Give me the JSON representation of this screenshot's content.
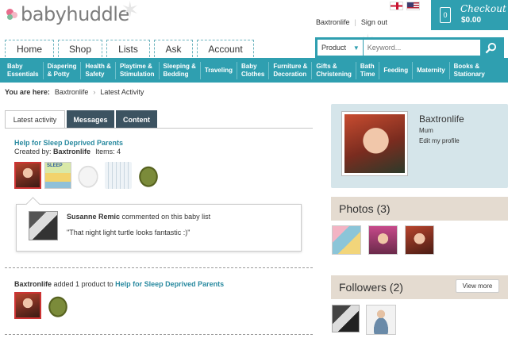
{
  "header": {
    "logo_text": "babyhuddle",
    "user_name": "Baxtronlife",
    "sign_out": "Sign out",
    "checkout_label": "Checkout",
    "cart_count": "0",
    "cart_total": "$0.00",
    "flags": [
      "uk-flag",
      "us-flag"
    ]
  },
  "main_nav": [
    "Home",
    "Shop",
    "Lists",
    "Ask",
    "Account"
  ],
  "search": {
    "category": "Product",
    "placeholder": "Keyword..."
  },
  "categories": [
    [
      "Baby",
      "Essentials"
    ],
    [
      "Diapering",
      "& Potty"
    ],
    [
      "Health &",
      "Safety"
    ],
    [
      "Playtime &",
      "Stimulation"
    ],
    [
      "Sleeping &",
      "Bedding"
    ],
    [
      "Traveling",
      ""
    ],
    [
      "Baby",
      "Clothes"
    ],
    [
      "Furniture &",
      "Decoration"
    ],
    [
      "Gifts &",
      "Christening"
    ],
    [
      "Bath",
      "Time"
    ],
    [
      "Feeding",
      ""
    ],
    [
      "Maternity",
      ""
    ],
    [
      "Books &",
      "Stationary"
    ]
  ],
  "breadcrumb": {
    "label": "You are here:",
    "items": [
      "Baxtronlife",
      "Latest Activity"
    ]
  },
  "tabs": [
    "Latest activity",
    "Messages",
    "Content"
  ],
  "activity1": {
    "title": "Help for Sleep Deprived Parents",
    "created_by_label": "Created by:",
    "creator": "Baxtronlife",
    "items_label": "Items: 4",
    "book_text": "SLEEP",
    "comment": {
      "author": "Susanne Remic",
      "action": "commented on this baby list",
      "text": "\"That night light turtle looks fantastic :)\""
    }
  },
  "activity2": {
    "user": "Baxtronlife",
    "action": "added 1 product to",
    "list": "Help for Sleep Deprived Parents"
  },
  "profile": {
    "name": "Baxtronlife",
    "role": "Mum",
    "edit_link": "Edit my profile"
  },
  "photos": {
    "heading": "Photos (3)"
  },
  "followers": {
    "heading": "Followers (2)",
    "view_more": "View more"
  },
  "colors": {
    "teal": "#2f9fb0",
    "link": "#2a8aa0",
    "dark_tab": "#3c5361",
    "profile_bg": "#d5e5ea",
    "panel_bg": "#e4dbd0"
  }
}
